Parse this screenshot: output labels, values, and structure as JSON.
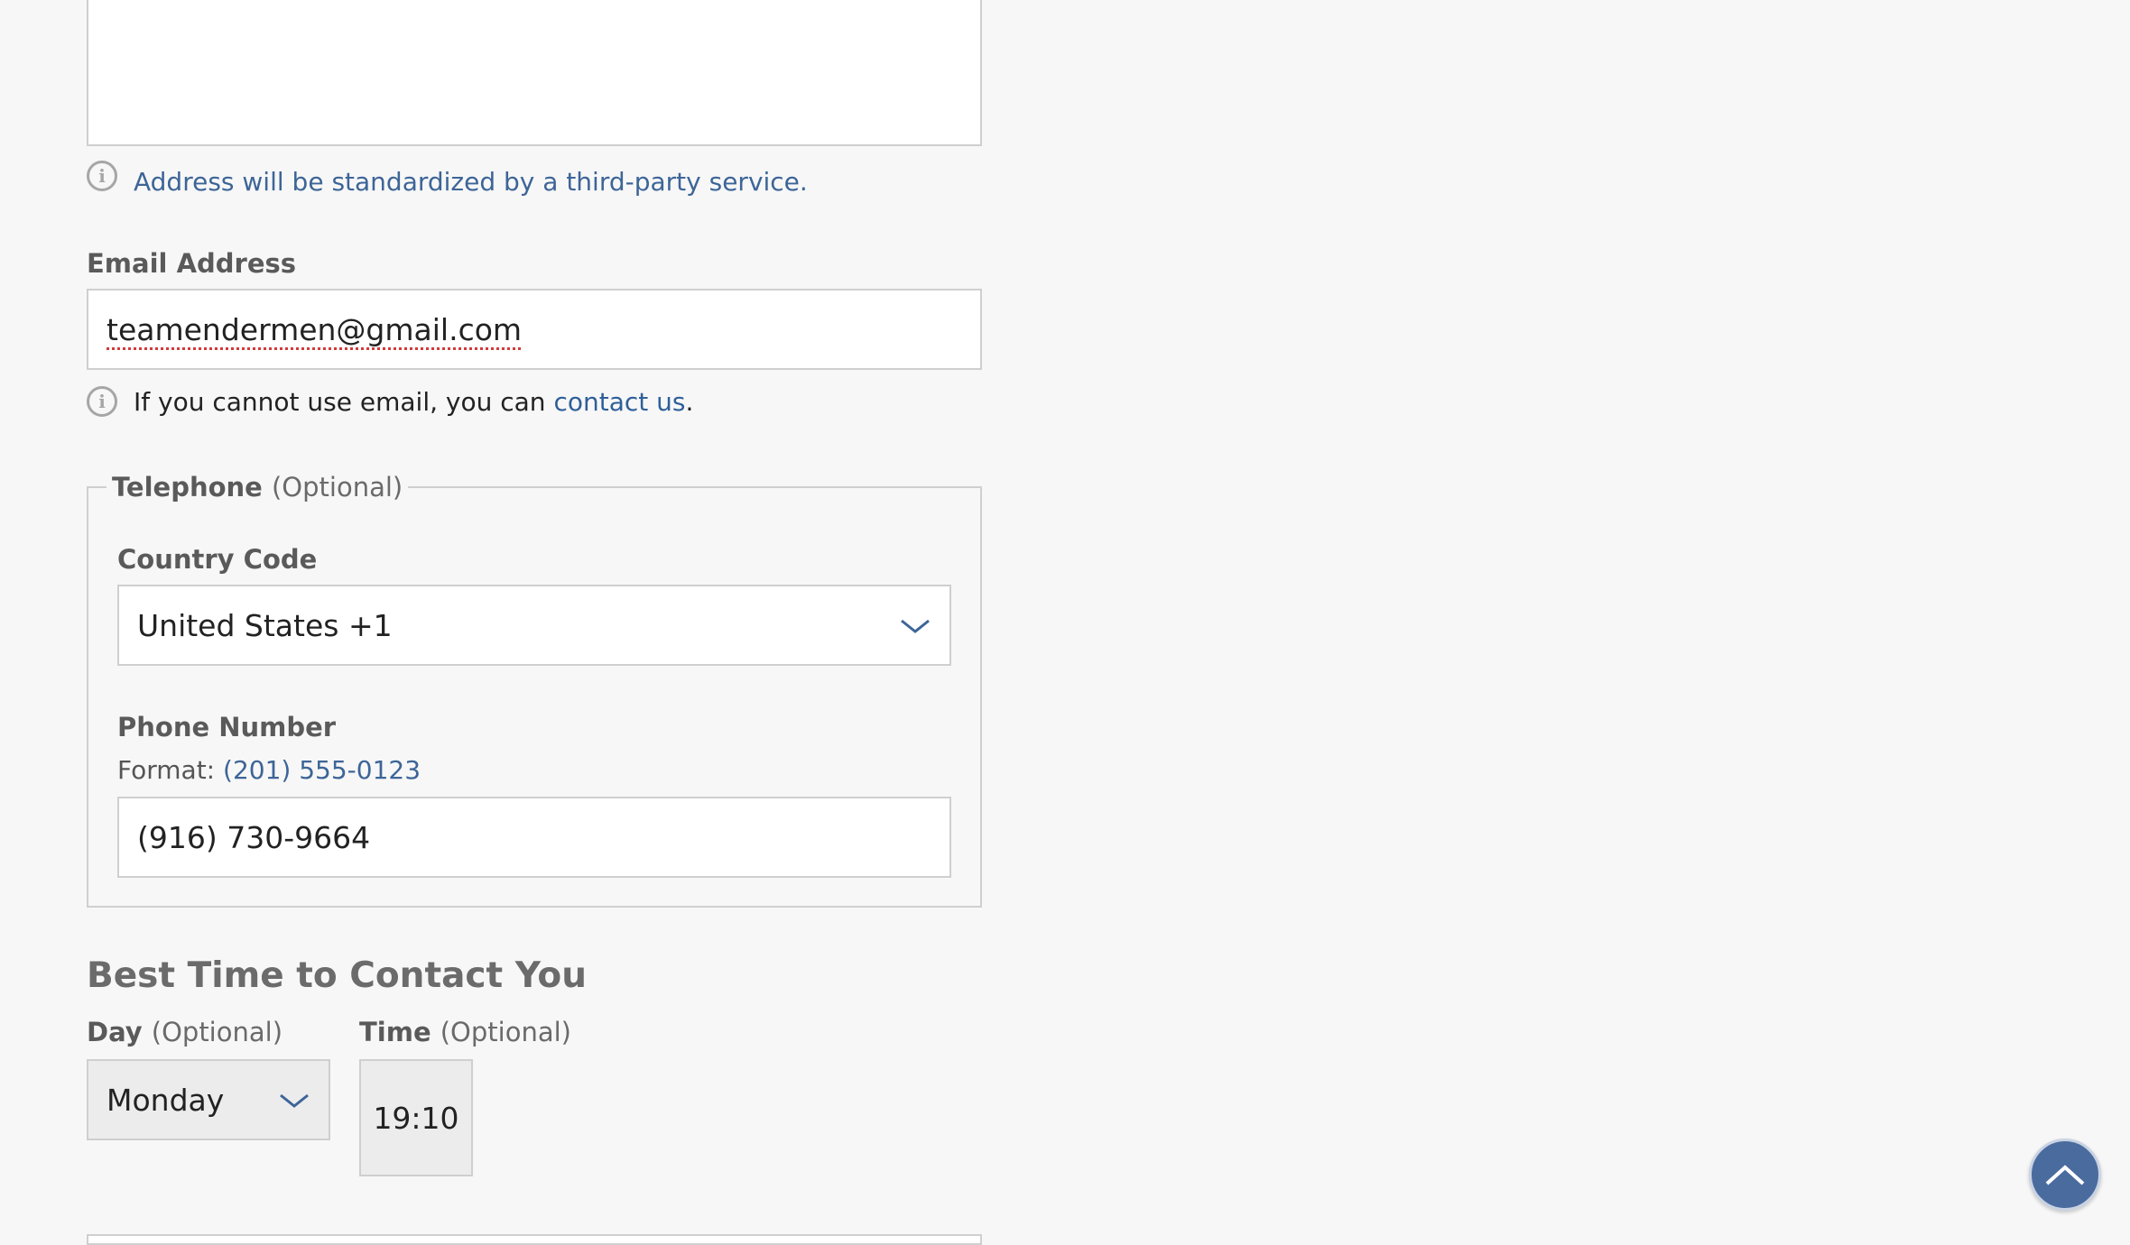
{
  "address": {
    "hint": "Address will be standardized by a third-party service."
  },
  "email": {
    "label": "Email Address",
    "value": "teamendermen@gmail.com",
    "hint_prefix": "If you cannot use email, you can ",
    "hint_link": "contact us",
    "hint_suffix": "."
  },
  "telephone": {
    "legend": "Telephone",
    "optional": "(Optional)",
    "country_code": {
      "label": "Country Code",
      "selected": "United States +1"
    },
    "phone_number": {
      "label": "Phone Number",
      "format_prefix": "Format: ",
      "format_example": "(201) 555-0123",
      "value": "(916) 730-9664"
    }
  },
  "best_time": {
    "title": "Best Time to Contact You",
    "day": {
      "label": "Day",
      "optional": "(Optional)",
      "selected": "Monday"
    },
    "time": {
      "label": "Time",
      "optional": "(Optional)",
      "value": "19:10"
    }
  },
  "icons": {
    "info": "info-icon",
    "chevron": "chevron-down-icon",
    "scroll_top": "chevron-up-icon"
  },
  "colors": {
    "link": "#2f5f9a",
    "hint": "#3d6597",
    "scroll_button": "#4a6b9e",
    "background": "#f7f7f7"
  }
}
